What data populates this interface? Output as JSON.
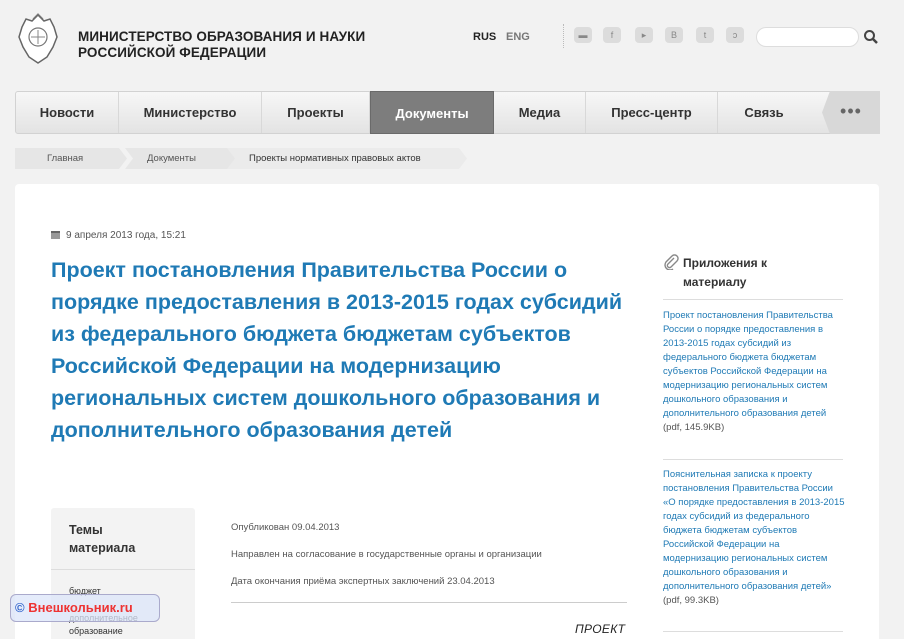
{
  "header": {
    "title_line1": "МИНИСТЕРСТВО ОБРАЗОВАНИЯ И НАУКИ",
    "title_line2": "РОССИЙСКОЙ ФЕДЕРАЦИИ",
    "lang_rus": "RUS",
    "lang_eng": "ENG",
    "social_icons": [
      "chat-icon",
      "facebook-icon",
      "youtube-icon",
      "vk-icon",
      "twitter-icon",
      "rss-icon"
    ],
    "search_placeholder": ""
  },
  "nav": {
    "items": [
      {
        "label": "Новости"
      },
      {
        "label": "Министерство"
      },
      {
        "label": "Проекты"
      },
      {
        "label": "Документы"
      },
      {
        "label": "Медиа"
      },
      {
        "label": "Пресс-центр"
      },
      {
        "label": "Связь"
      }
    ],
    "active": "Документы",
    "more": "•••"
  },
  "breadcrumb": {
    "items": [
      "Главная",
      "Документы",
      "Проекты нормативных правовых актов"
    ]
  },
  "article": {
    "date": "9 апреля 2013 года, 15:21",
    "title": "Проект постановления Правительства России о порядке предоставления в 2013-2015 годах субсидий из федерального бюджета бюджетам субъектов Российской Федерации на модернизацию региональных систем дошкольного образования и дополнительного образования детей",
    "published": "Опубликован 09.04.2013",
    "status": "Направлен на согласование в государственные органы и организации",
    "deadline": "Дата окончания приёма экспертных заключений 23.04.2013",
    "project_label": "ПРОЕКТ"
  },
  "topics": {
    "title": "Темы материала",
    "items": [
      "бюджет",
      "дополнительное образование"
    ]
  },
  "sidebar": {
    "title": "Приложения к материалу",
    "attachments": [
      {
        "text": "Проект постановления Правительства России о порядке предоставления в 2013-2015 годах субсидий из федерального бюджета бюджетам субъектов Российской Федерации на модернизацию региональных систем дошкольного образования и дополнительного образования детей",
        "size": "(pdf, 145.9KB)"
      },
      {
        "text": "Пояснительная записка к проекту постановления Правительства России «О порядке предоставления в 2013-2015 годах субсидий из федерального бюджета бюджетам субъектов Российской Федерации на модернизацию региональных систем дошкольного образования и дополнительного образования детей»",
        "size": "(pdf, 99.3KB)"
      }
    ]
  },
  "watermark": {
    "symbol": "©",
    "text": "Внешкольник.ru"
  },
  "colors": {
    "link": "#1f7ab5",
    "nav_active": "#7d7d7d",
    "panel_bg": "#ffffff",
    "page_bg": "#f2f2f2"
  }
}
